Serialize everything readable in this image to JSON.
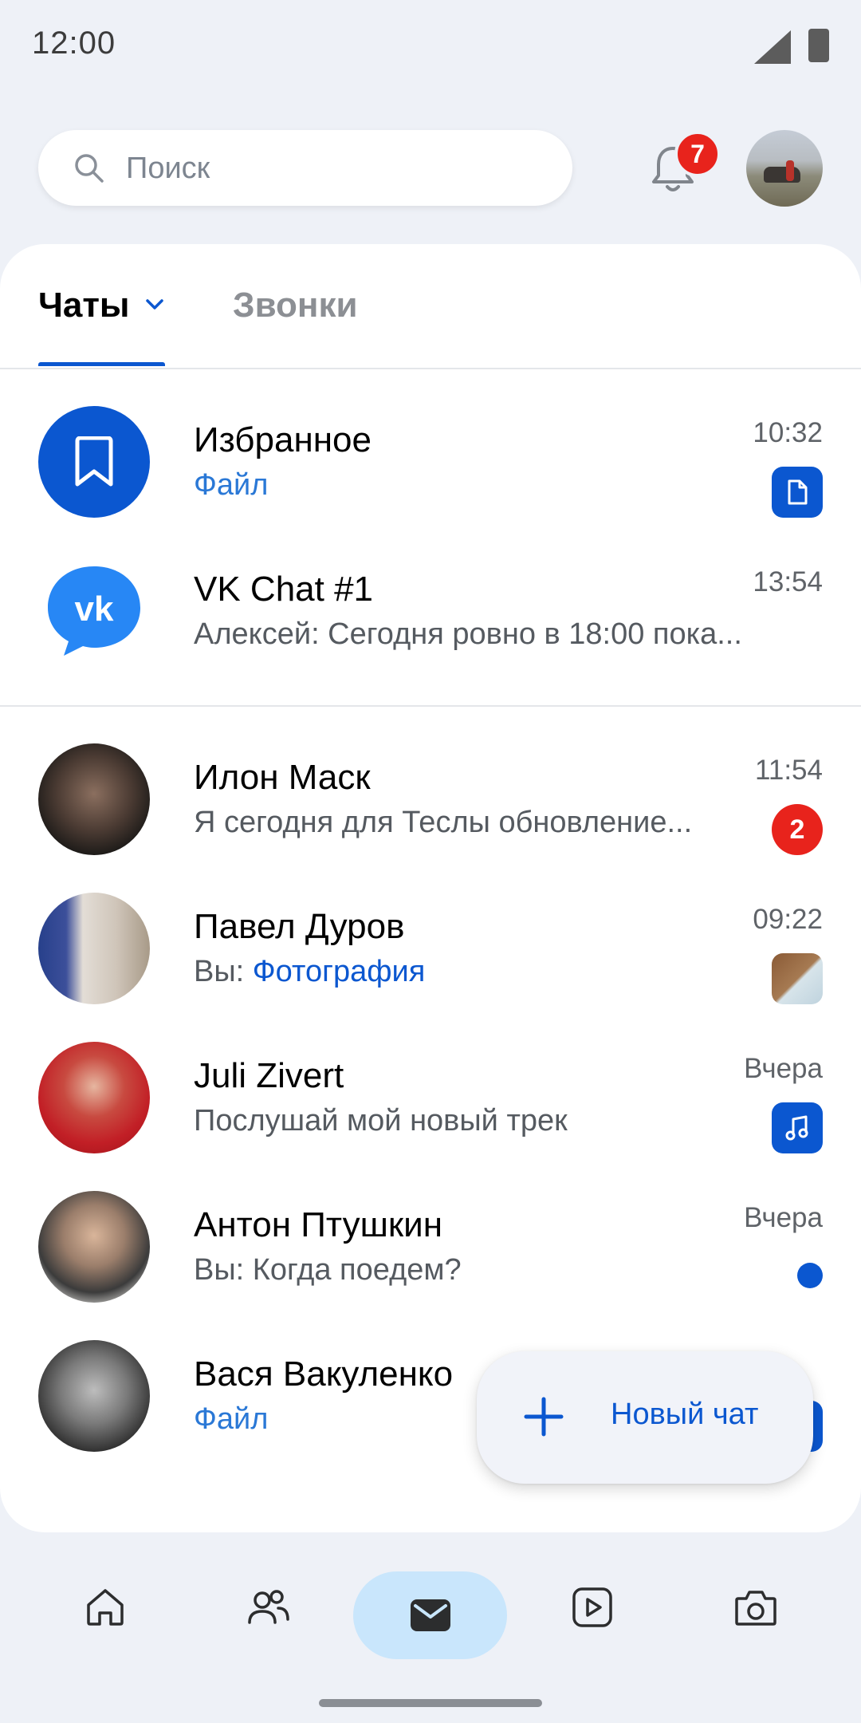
{
  "status_bar": {
    "time": "12:00"
  },
  "search": {
    "placeholder": "Поиск"
  },
  "notifications": {
    "count": "7"
  },
  "tabs": {
    "chats": "Чаты",
    "calls": "Звонки"
  },
  "chats": [
    {
      "name": "Избранное",
      "preview": "Файл",
      "time": "10:32",
      "indicator": "file"
    },
    {
      "name": "VK Chat #1",
      "preview": "Алексей: Сегодня ровно в 18:00 пока...",
      "time": "13:54",
      "indicator": ""
    },
    {
      "name": "Илон Маск",
      "preview": "Я сегодня для Теслы обновление...",
      "time": "11:54",
      "indicator": "unread",
      "unread": "2"
    },
    {
      "name": "Павел Дуров",
      "preview_prefix": "Вы: ",
      "preview": "Фотография",
      "time": "09:22",
      "indicator": "photo"
    },
    {
      "name": "Juli Zivert",
      "preview": "Послушай мой новый трек",
      "time": "Вчера",
      "indicator": "music"
    },
    {
      "name": "Антон Птушкин",
      "preview": "Вы: Когда поедем?",
      "time": "Вчера",
      "indicator": "dot"
    },
    {
      "name": "Вася Вакуленко",
      "preview": "Файл",
      "time": "",
      "indicator": "file"
    }
  ],
  "fab": {
    "label": "Новый чат"
  },
  "bottom_nav": [
    "home-icon",
    "friends-icon",
    "messages-icon",
    "video-icon",
    "camera-icon"
  ],
  "colors": {
    "accent": "#0b57d0",
    "badge": "#e8231c",
    "nav_active": "#c9e6fc"
  }
}
